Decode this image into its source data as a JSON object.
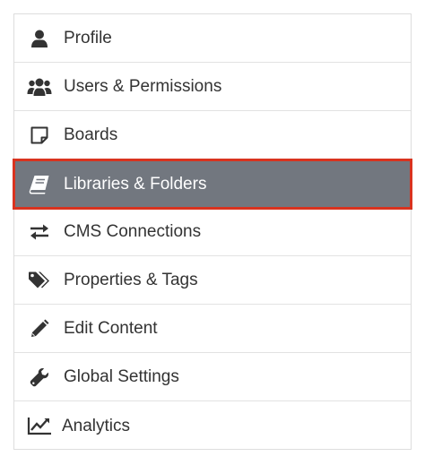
{
  "menu": {
    "items": [
      {
        "label": "Profile",
        "icon": "user-icon",
        "active": false
      },
      {
        "label": "Users & Permissions",
        "icon": "users-icon",
        "active": false
      },
      {
        "label": "Boards",
        "icon": "sticky-note-icon",
        "active": false
      },
      {
        "label": "Libraries & Folders",
        "icon": "book-icon",
        "active": true
      },
      {
        "label": "CMS Connections",
        "icon": "exchange-icon",
        "active": false
      },
      {
        "label": "Properties & Tags",
        "icon": "tags-icon",
        "active": false
      },
      {
        "label": "Edit Content",
        "icon": "pencil-icon",
        "active": false
      },
      {
        "label": "Global Settings",
        "icon": "wrench-icon",
        "active": false
      },
      {
        "label": "Analytics",
        "icon": "line-chart-icon",
        "active": false
      }
    ]
  },
  "colors": {
    "active_background": "#72777f",
    "active_border": "#d9331f",
    "text": "#333333",
    "icon": "#333333",
    "divider": "#e2e2e2"
  }
}
